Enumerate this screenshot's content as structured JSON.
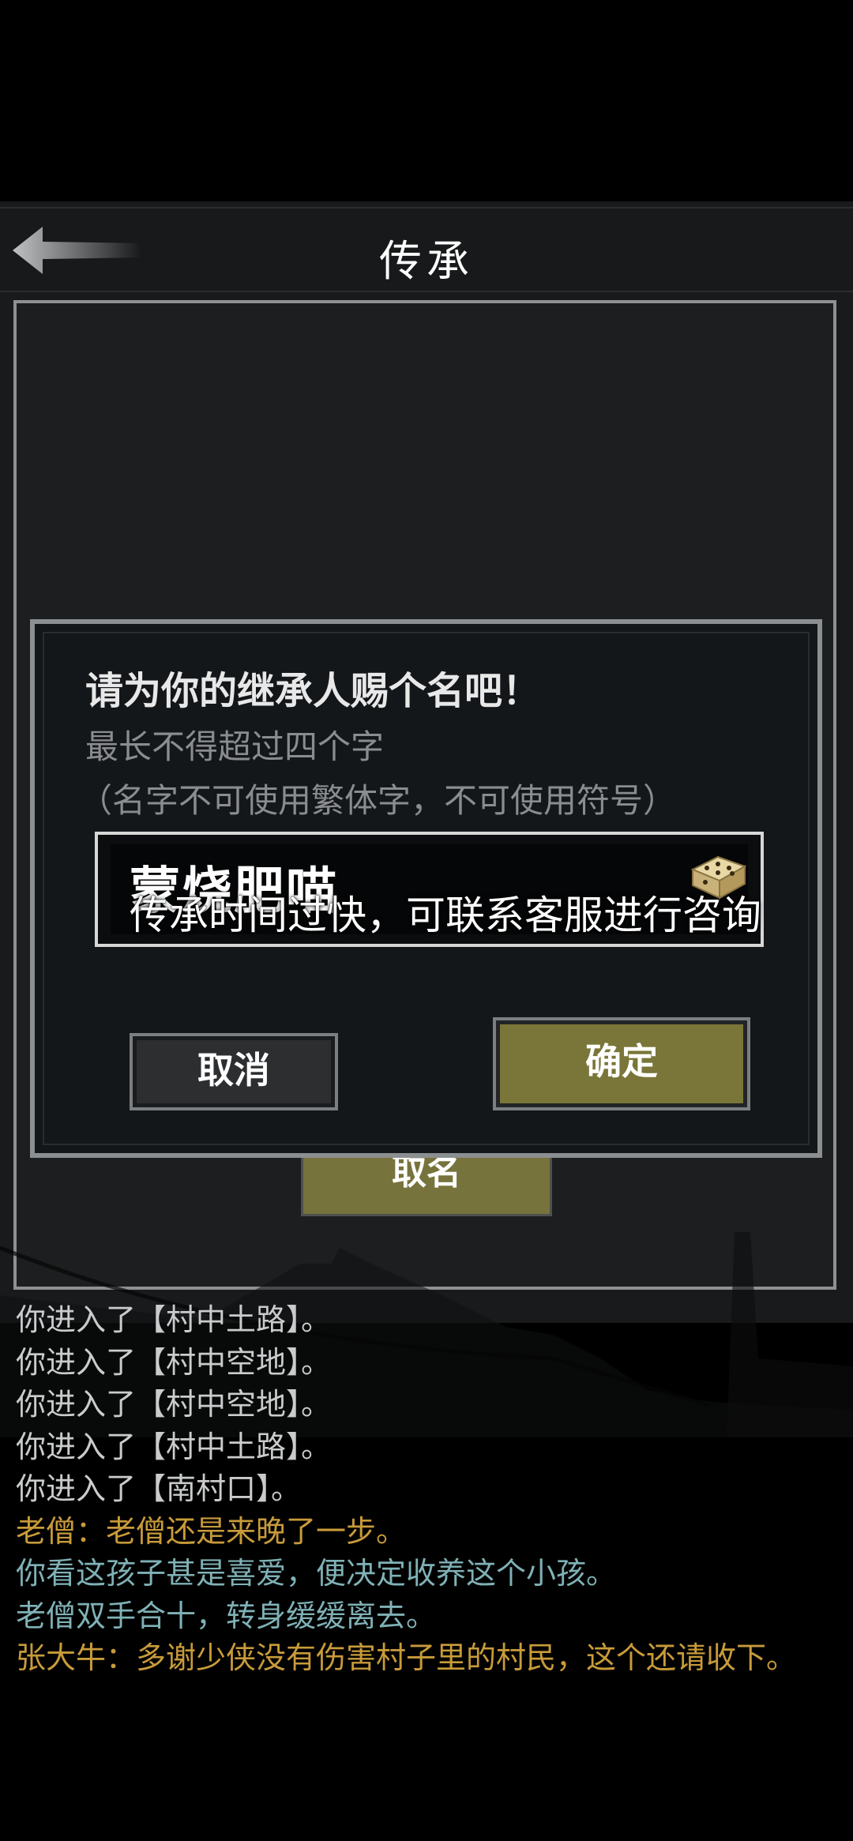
{
  "header": {
    "title": "传承"
  },
  "panel": {
    "name_button_label": "取名"
  },
  "log": [
    {
      "text": "你进入了【村中土路】。",
      "color": "white"
    },
    {
      "text": "你进入了【村中空地】。",
      "color": "white"
    },
    {
      "text": "你进入了【村中空地】。",
      "color": "white"
    },
    {
      "text": "你进入了【村中土路】。",
      "color": "white"
    },
    {
      "text": "你进入了【南村口】。",
      "color": "white"
    },
    {
      "text": "老僧：老僧还是来晚了一步。",
      "color": "orange"
    },
    {
      "text": "你看这孩子甚是喜爱，便决定收养这个小孩。",
      "color": "teal"
    },
    {
      "text": "老僧双手合十，转身缓缓离去。",
      "color": "teal"
    },
    {
      "text": "张大牛：多谢少侠没有伤害村子里的村民，这个还请收下。",
      "color": "orange"
    }
  ],
  "dialog": {
    "title": "请为你的继承人赐个名吧！",
    "subtitle1": "最长不得超过四个字",
    "subtitle2": "（名字不可使用繁体字，不可使用符号）",
    "input_value": "蒙烧肥喵",
    "toast": "传承时间过快，可联系客服进行咨询",
    "cancel_label": "取消",
    "ok_label": "确定"
  },
  "colors": {
    "orange": "#c89b3a",
    "teal": "#7fb1b6",
    "white": "#c9cbcc",
    "button_olive": "#7a7639"
  },
  "icons": {
    "back": "back-arrow-icon",
    "dice": "dice-icon"
  }
}
